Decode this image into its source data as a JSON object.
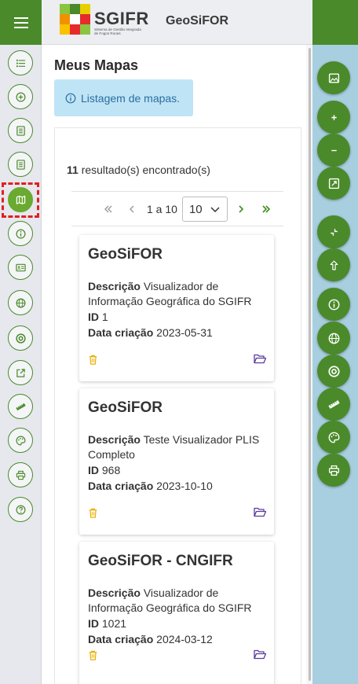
{
  "header": {
    "logo_text": "SGIFR",
    "logo_subtitle": "Sistema de Gestão Integrada de Fogos Rurais",
    "app_title": "GeoSiFOR"
  },
  "sidebar": {
    "items": [
      {
        "name": "list",
        "icon": "list-icon"
      },
      {
        "name": "add",
        "icon": "plus-circle-icon"
      },
      {
        "name": "document",
        "icon": "document-icon"
      },
      {
        "name": "document-2",
        "icon": "document-icon"
      },
      {
        "name": "maps",
        "icon": "map-icon",
        "active": true
      },
      {
        "name": "info",
        "icon": "info-icon"
      },
      {
        "name": "contact-card",
        "icon": "id-card-icon"
      },
      {
        "name": "globe",
        "icon": "globe-icon"
      },
      {
        "name": "target",
        "icon": "target-icon"
      },
      {
        "name": "external",
        "icon": "external-link-icon"
      },
      {
        "name": "ruler",
        "icon": "ruler-icon"
      },
      {
        "name": "palette",
        "icon": "palette-icon"
      },
      {
        "name": "print",
        "icon": "print-icon"
      },
      {
        "name": "help",
        "icon": "help-icon"
      }
    ]
  },
  "main": {
    "title": "Meus Mapas",
    "info_message": "Listagem de mapas.",
    "result_count": "11",
    "result_label": " resultado(s) encontrado(s)",
    "pagination": {
      "range": "1 a 10",
      "page_size": "10"
    },
    "cards": [
      {
        "title": "GeoSiFOR",
        "description_label": "Descrição",
        "description": "Visualizador de Informação Geográfica do SGIFR",
        "id_label": "ID",
        "id": "1",
        "date_label": "Data criação",
        "date": "2023-05-31"
      },
      {
        "title": "GeoSiFOR",
        "description_label": "Descrição",
        "description": "Teste Visualizador PLIS Completo",
        "id_label": "ID",
        "id": "968",
        "date_label": "Data criação",
        "date": "2023-10-10"
      },
      {
        "title": "GeoSiFOR - CNGIFR",
        "description_label": "Descrição",
        "description": "Visualizador de Informação Geográfica do SGIFR",
        "id_label": "ID",
        "id": "1021",
        "date_label": "Data criação",
        "date": "2024-03-12"
      }
    ]
  },
  "right_toolbar": {
    "items": [
      "image-icon",
      "zoom-in-icon",
      "zoom-out-icon",
      "fit-extent-icon",
      "collapse-icon",
      "arrow-up-icon",
      "info-icon",
      "globe-icon",
      "target-icon",
      "ruler-icon",
      "palette-icon",
      "print-icon"
    ]
  },
  "colors": {
    "brand_green": "#4a8a2a",
    "active_green": "#6aaa30",
    "info_bg": "#bfe4f6",
    "right_panel_bg": "#a8cfe0",
    "trash_icon": "#e8b000",
    "folder_icon": "#5a3b9a"
  }
}
